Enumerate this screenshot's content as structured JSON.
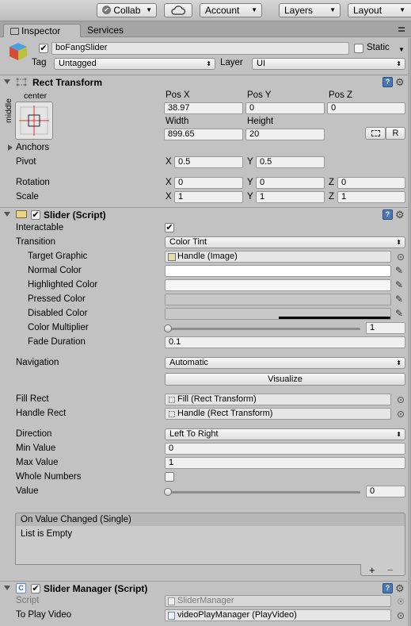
{
  "toolbar": {
    "collab": "Collab",
    "account": "Account",
    "layers": "Layers",
    "layout": "Layout"
  },
  "tabs": {
    "inspector": "Inspector",
    "services": "Services"
  },
  "object": {
    "name": "boFangSlider",
    "static_label": "Static",
    "tag_label": "Tag",
    "tag_value": "Untagged",
    "layer_label": "Layer",
    "layer_value": "UI"
  },
  "rect_transform": {
    "title": "Rect Transform",
    "anchor_h": "center",
    "anchor_v": "middle",
    "posx_label": "Pos X",
    "posy_label": "Pos Y",
    "posz_label": "Pos Z",
    "posx": "38.97",
    "posy": "0",
    "posz": "0",
    "width_label": "Width",
    "height_label": "Height",
    "width": "899.65",
    "height": "20",
    "r_button": "R",
    "anchors_label": "Anchors",
    "pivot_label": "Pivot",
    "pivot_x": "0.5",
    "pivot_y": "0.5",
    "rotation_label": "Rotation",
    "rot_x": "0",
    "rot_y": "0",
    "rot_z": "0",
    "scale_label": "Scale",
    "scale_x": "1",
    "scale_y": "1",
    "scale_z": "1",
    "x": "X",
    "y": "Y",
    "z": "Z"
  },
  "slider": {
    "title": "Slider (Script)",
    "interactable_label": "Interactable",
    "transition_label": "Transition",
    "transition_value": "Color Tint",
    "target_graphic_label": "Target Graphic",
    "target_graphic_value": "Handle (Image)",
    "normal_color_label": "Normal Color",
    "highlighted_color_label": "Highlighted Color",
    "pressed_color_label": "Pressed Color",
    "disabled_color_label": "Disabled Color",
    "color_multiplier_label": "Color Multiplier",
    "color_multiplier_value": "1",
    "color_multiplier_fraction": 0.0,
    "fade_duration_label": "Fade Duration",
    "fade_duration_value": "0.1",
    "navigation_label": "Navigation",
    "navigation_value": "Automatic",
    "visualize_label": "Visualize",
    "fill_rect_label": "Fill Rect",
    "fill_rect_value": "Fill (Rect Transform)",
    "handle_rect_label": "Handle Rect",
    "handle_rect_value": "Handle (Rect Transform)",
    "direction_label": "Direction",
    "direction_value": "Left To Right",
    "min_value_label": "Min Value",
    "min_value": "0",
    "max_value_label": "Max Value",
    "max_value": "1",
    "whole_numbers_label": "Whole Numbers",
    "value_label": "Value",
    "value": "0",
    "value_fraction": 0.0,
    "event_title": "On Value Changed (Single)",
    "event_empty": "List is Empty",
    "plus": "+",
    "minus": "−",
    "colors": {
      "normal": "#ffffff",
      "highlighted": "#f5f5f5",
      "pressed": "#c8c8c8",
      "disabled": "#c8c8c8"
    }
  },
  "slider_manager": {
    "title": "Slider Manager (Script)",
    "script_label": "Script",
    "script_value": "SliderManager",
    "to_play_video_label": "To Play Video",
    "to_play_video_value": "videoPlayManager (PlayVideo)"
  },
  "icons": {
    "help": "?",
    "gear": "⚙",
    "check": "✔",
    "pipette": "✎"
  }
}
